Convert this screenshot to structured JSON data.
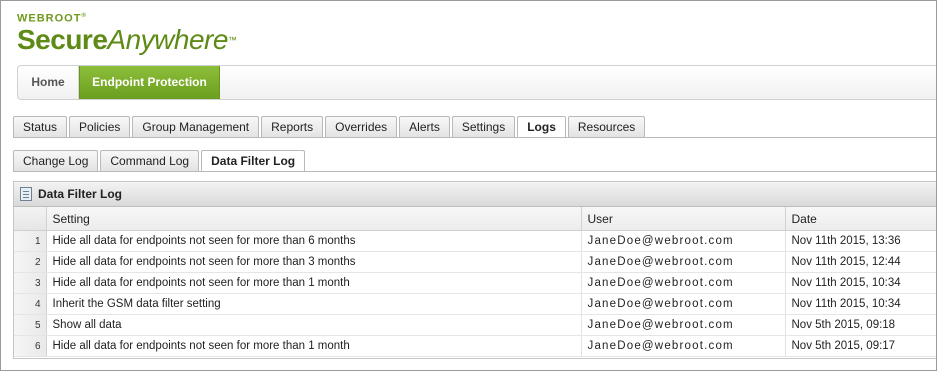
{
  "logo": {
    "brand": "WEBROOT",
    "product_bold": "Secure",
    "product_italic": "Anywhere",
    "tm": "™"
  },
  "topnav": {
    "home": "Home",
    "endpoint": "Endpoint Protection"
  },
  "tabs": [
    "Status",
    "Policies",
    "Group Management",
    "Reports",
    "Overrides",
    "Alerts",
    "Settings",
    "Logs",
    "Resources"
  ],
  "active_tab": "Logs",
  "subtabs": [
    "Change Log",
    "Command Log",
    "Data Filter Log"
  ],
  "active_subtab": "Data Filter Log",
  "panel": {
    "title": "Data Filter Log"
  },
  "table": {
    "columns": [
      "Setting",
      "User",
      "Date"
    ],
    "rows": [
      {
        "num": "1",
        "setting": "Hide all data for endpoints not seen for more than 6 months",
        "user": "JaneDoe@webroot.com",
        "date": "Nov 11th 2015, 13:36"
      },
      {
        "num": "2",
        "setting": "Hide all data for endpoints not seen for more than 3 months",
        "user": "JaneDoe@webroot.com",
        "date": "Nov 11th 2015, 12:44"
      },
      {
        "num": "3",
        "setting": "Hide all data for endpoints not seen for more than 1 month",
        "user": "JaneDoe@webroot.com",
        "date": "Nov 11th 2015, 10:34"
      },
      {
        "num": "4",
        "setting": "Inherit the GSM data filter setting",
        "user": "JaneDoe@webroot.com",
        "date": "Nov 11th 2015, 10:34"
      },
      {
        "num": "5",
        "setting": "Show all data",
        "user": "JaneDoe@webroot.com",
        "date": "Nov 5th 2015, 09:18"
      },
      {
        "num": "6",
        "setting": "Hide all data for endpoints not seen for more than 1 month",
        "user": "JaneDoe@webroot.com",
        "date": "Nov 5th 2015, 09:17"
      }
    ]
  },
  "colors": {
    "brand_green": "#6c9e1f",
    "brand_green_light": "#8cbf3a"
  }
}
